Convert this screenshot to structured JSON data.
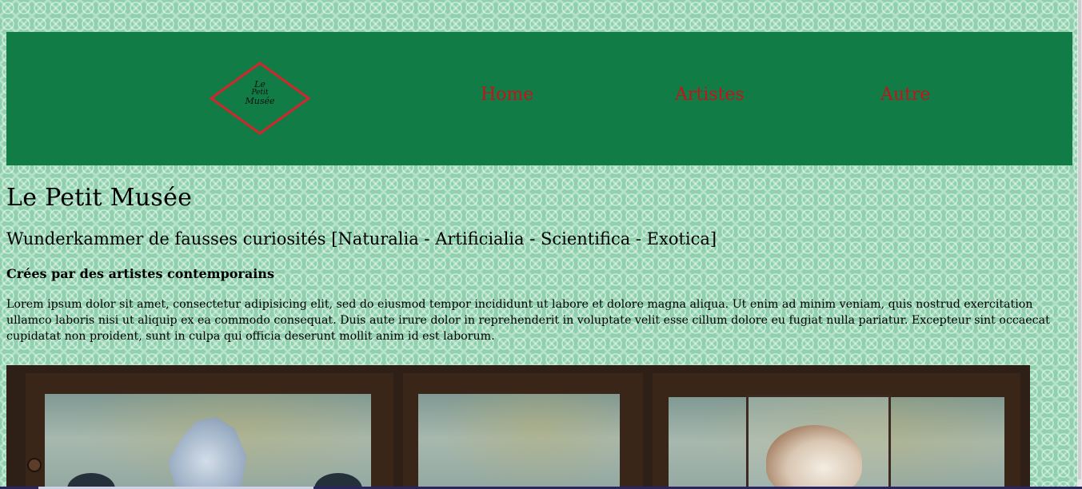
{
  "header": {
    "logo_line1": "Le",
    "logo_line2": "Petit",
    "logo_line3": "Musée",
    "logo_border_color": "#d2262d",
    "background_color": "#117c45"
  },
  "nav": {
    "items": [
      {
        "label": "Home"
      },
      {
        "label": "Artistes"
      },
      {
        "label": "Autre"
      }
    ],
    "link_color": "#c3141c"
  },
  "main": {
    "title": "Le Petit Musée",
    "subtitle": "Wunderkammer de fausses curiosités [Naturalia - Artificialia - Scientifica - Exotica]",
    "tagline": "Crées par des artistes contemporains",
    "body": "Lorem ipsum dolor sit amet, consectetur adipisicing elit, sed do eiusmod tempor incididunt ut labore et dolore magna aliqua. Ut enim ad minim veniam, quis nostrud exercitation ullamco laboris nisi ut aliquip ex ea commodo consequat. Duis aute irure dolor in reprehenderit in voluptate velit esse cillum dolore eu fugiat nulla pariatur. Excepteur sint occaecat cupidatat non proident, sunt in culpa qui officia deserunt mollit anim id est laborum."
  },
  "page": {
    "background_color": "#8fd1ad"
  }
}
